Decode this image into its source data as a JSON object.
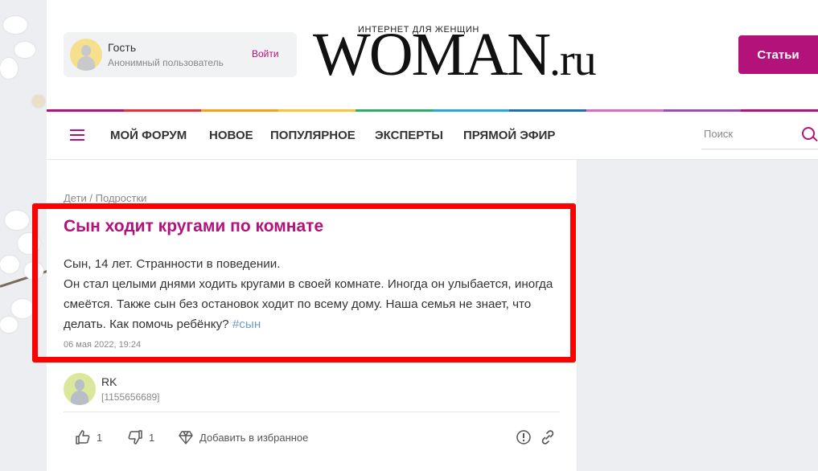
{
  "user_box": {
    "name": "Гость",
    "subtitle": "Анонимный пользователь",
    "login": "Войти"
  },
  "logo": {
    "tagline": "ИНТЕРНЕТ ДЛЯ ЖЕНЩИН",
    "main": "WOMAN",
    "suffix": ".ru"
  },
  "header": {
    "articles_button": "Статьи"
  },
  "nav": {
    "items": [
      "МОЙ ФОРУМ",
      "НОВОЕ",
      "ПОПУЛЯРНОЕ",
      "ЭКСПЕРТЫ",
      "ПРЯМОЙ ЭФИР"
    ],
    "search_placeholder": "Поиск"
  },
  "post": {
    "breadcrumb": "Дети / Подростки",
    "title": "Сын ходит кругами по комнате",
    "body_line1": "Сын, 14 лет. Странности в поведении.",
    "body_line2": "Он стал целыми днями ходить кругами в своей комнате. Иногда он улыбается, иногда смеётся. Также сын без остановок ходит по всему дому. Наша семья не знает, что делать. Как помочь ребёнку?",
    "hashtag": "#сын",
    "date": "06 мая 2022, 19:24"
  },
  "author": {
    "name": "RK",
    "id": "[1155656689]"
  },
  "actions": {
    "likes": "1",
    "dislikes": "1",
    "favorite": "Добавить в избранное"
  },
  "colors": {
    "brand": "#b3127a",
    "highlight": "#ff0000",
    "hashtag": "#6d9ec9",
    "rainbow": [
      "#b3127a",
      "#e3323a",
      "#f3a21b",
      "#f5c53a",
      "#2eab6f",
      "#29a7d9",
      "#1f6fb2",
      "#d86bc2",
      "#9a4bb8",
      "#b3127a"
    ]
  },
  "icons": [
    "user-avatar-icon",
    "hamburger-menu-icon",
    "search-icon",
    "thumbs-up-icon",
    "thumbs-down-icon",
    "diamond-icon",
    "report-icon",
    "link-icon"
  ]
}
